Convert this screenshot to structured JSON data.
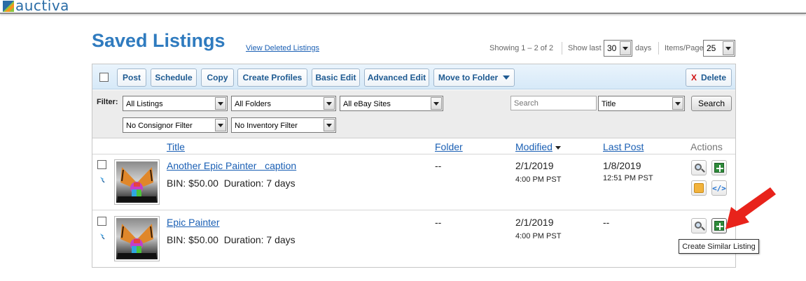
{
  "brand": {
    "name": "auctiva"
  },
  "header": {
    "title": "Saved Listings",
    "view_deleted": "View Deleted Listings",
    "showing": "Showing 1 – 2 of 2",
    "show_last_label": "Show last",
    "show_last_value": "30",
    "days_label": "days",
    "items_per_page_label": "Items/Page",
    "items_per_page_value": "25"
  },
  "toolbar": {
    "post": "Post",
    "schedule": "Schedule",
    "copy": "Copy",
    "create_profiles": "Create Profiles",
    "basic_edit": "Basic Edit",
    "advanced_edit": "Advanced Edit",
    "move_to_folder": "Move to Folder",
    "delete_x": "X",
    "delete": "Delete"
  },
  "filter": {
    "label": "Filter:",
    "listings": "All Listings",
    "folders": "All Folders",
    "ebay_sites": "All eBay Sites",
    "consignor": "No Consignor Filter",
    "inventory": "No Inventory Filter",
    "search_placeholder": "Search",
    "search_field": "Title",
    "search_button": "Search"
  },
  "columns": {
    "title": "Title",
    "folder": "Folder",
    "modified": "Modified",
    "last_post": "Last Post",
    "actions": "Actions"
  },
  "rows": [
    {
      "title": "Another Epic Painter   caption",
      "price": "BIN: $50.00",
      "duration": "Duration: 7 days",
      "folder": "--",
      "modified_date": "2/1/2019",
      "modified_time": "4:00 PM PST",
      "last_post_date": "1/8/2019",
      "last_post_time": "12:51 PM PST",
      "code_icon": "</>"
    },
    {
      "title": "Epic Painter",
      "price": "BIN: $50.00",
      "duration": "Duration: 7 days",
      "folder": "--",
      "modified_date": "2/1/2019",
      "modified_time": "4:00 PM PST",
      "last_post_date": "--"
    }
  ],
  "tooltip": "Create Similar Listing",
  "colors": {
    "brand_blue": "#2f7bbf",
    "link": "#1a5fb4",
    "annotation_red": "#e8231b",
    "action_green": "#2e8b3a"
  },
  "icons": [
    "magnifier-icon",
    "create-similar-icon",
    "note-icon",
    "code-icon",
    "pin-icon",
    "dropdown-arrow-icon"
  ]
}
